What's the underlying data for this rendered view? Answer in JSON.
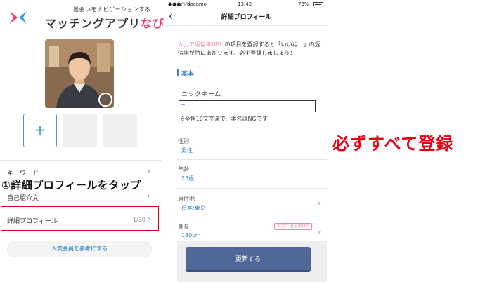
{
  "left_screen": {
    "tagline": "出会いをナビゲーションする",
    "brand_main": "マッチングアプリ",
    "brand_accent": "なび",
    "add_photo_icon": "+",
    "more_icon": "…",
    "menu": {
      "keyword_label": "キーワード",
      "self_intro_label": "自己紹介文",
      "detail_profile_label": "詳細プロフィール",
      "detail_profile_count": "1/30",
      "chevron": "›"
    },
    "annotation_step": "①詳細プロフィールをタップ",
    "popular_button_label": "人気会員を参考にする"
  },
  "phone": {
    "status": {
      "carrier": "docomo",
      "time": "13:42",
      "battery": "73%"
    },
    "nav": {
      "back_icon": "‹",
      "title": "詳細プロフィール"
    },
    "notice": {
      "highlight": "入力で返信率UP！",
      "rest": "の項目を登録すると「いいね！」の返信率が特にあがります。必ず登録しましょう！"
    },
    "section_title": "基本",
    "nickname": {
      "label": "ニックネーム",
      "value": "T",
      "hint": "※全角10文字まで、本名はNGです"
    },
    "fields": {
      "gender": {
        "label": "性別",
        "value": "男性"
      },
      "age": {
        "label": "年齢",
        "value": "23歳"
      },
      "residence": {
        "label": "居住地",
        "value": "日本:東京"
      },
      "height": {
        "label": "身長",
        "value": "180cm",
        "tag": "入力で返信率UP!"
      }
    },
    "update_button_label": "更新する"
  },
  "callout_text": "必ずすべて登録",
  "colors": {
    "accent_pink": "#ee3a6e",
    "link_blue": "#3a7fd0",
    "highlight_red": "#e60012",
    "update_button": "#4f6897"
  }
}
